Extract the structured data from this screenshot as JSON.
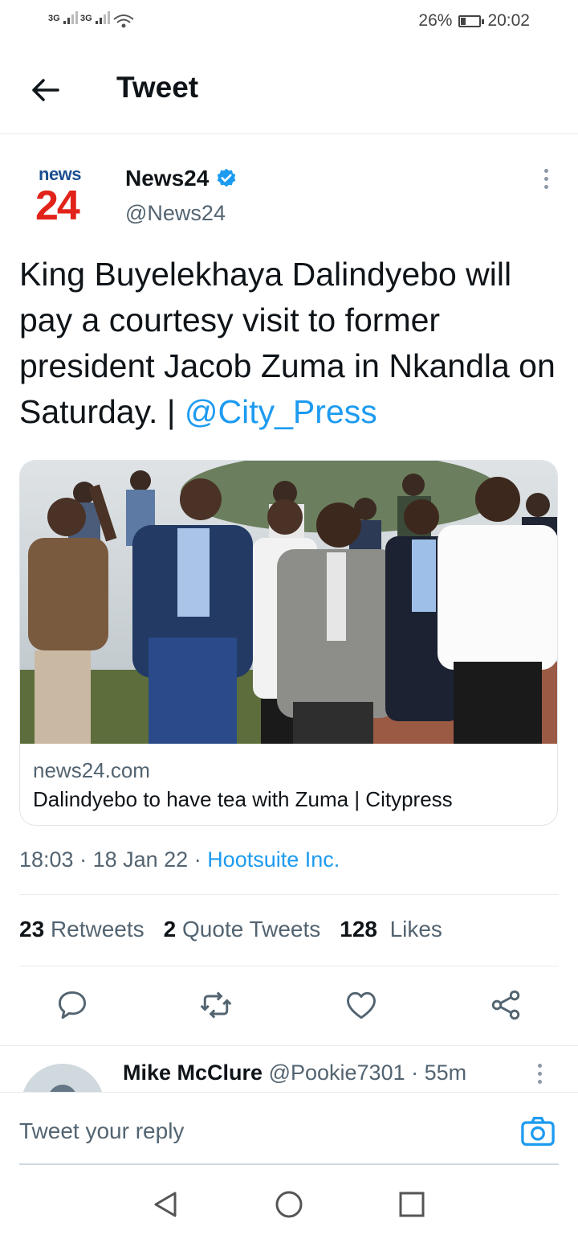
{
  "status_bar": {
    "signal1": "3G",
    "signal2": "3G",
    "battery_percent": "26%",
    "battery_level": 0.26,
    "time": "20:02"
  },
  "header": {
    "title": "Tweet"
  },
  "author": {
    "logo_top": "news",
    "logo_bottom": "24",
    "name": "News24",
    "handle": "@News24",
    "verified": true
  },
  "tweet": {
    "text": "King Buyelekhaya Dalindyebo will pay a courtesy visit to former president Jacob Zuma in Nkandla on Saturday. | ",
    "mention": "@City_Press"
  },
  "card": {
    "domain": "news24.com",
    "title": "Dalindyebo to have tea with Zuma | Citypress"
  },
  "meta": {
    "time": "18:03",
    "sep1": " · ",
    "date": "18 Jan 22",
    "sep2": " · ",
    "source": "Hootsuite Inc."
  },
  "stats": {
    "retweets_count": "23",
    "retweets_label": "Retweets",
    "quotes_count": "2",
    "quotes_label": "Quote Tweets",
    "likes_count": "128",
    "likes_label": "Likes"
  },
  "reply": {
    "name": "Mike McClure",
    "handle": "@Pookie7301",
    "sep": " · ",
    "time": "55m"
  },
  "composer": {
    "placeholder": "Tweet your reply"
  },
  "colors": {
    "accent": "#1d9bf0",
    "brand_red": "#e2231a",
    "brand_blue": "#1d4f91"
  },
  "icons": [
    "back-arrow-icon",
    "verified-badge-icon",
    "more-vertical-icon",
    "reply-icon",
    "retweet-icon",
    "like-icon",
    "share-icon",
    "camera-icon",
    "nav-back-icon",
    "nav-home-icon",
    "nav-recents-icon",
    "wifi-icon"
  ]
}
